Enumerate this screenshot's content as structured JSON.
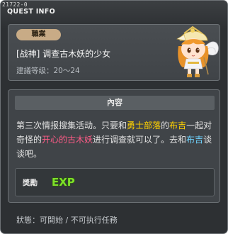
{
  "window": {
    "id_text": "21722-0",
    "title": "QUEST INFO"
  },
  "quest": {
    "job_tag": "職業",
    "name": "[战神] 调查古木妖的少女",
    "level_requirement": "建議等级：20～24"
  },
  "content": {
    "header": "內容",
    "description_parts": {
      "p1": "第三次情报搜集活动。只要和",
      "p2": "勇士部落",
      "p3": "的",
      "p4": "布吉",
      "p5": "一起对奇怪的",
      "p6": "开心的古木妖",
      "p7": "进行调查就可以了。去和",
      "p8": "布吉",
      "p9": "谈谈吧。"
    },
    "reward_label": "獎勵",
    "reward_icon": "EXP"
  },
  "status": "狀態：可開始 / 不可执行任務",
  "colors": {
    "highlight_place": "#ffd200",
    "highlight_npc": "#6fd4ff",
    "highlight_monster": "#ff5b87",
    "panel": "#404448",
    "background": "#2d3033"
  },
  "icons": {
    "npc": "angel-girl-npc-portrait",
    "reward": "exp-icon"
  }
}
